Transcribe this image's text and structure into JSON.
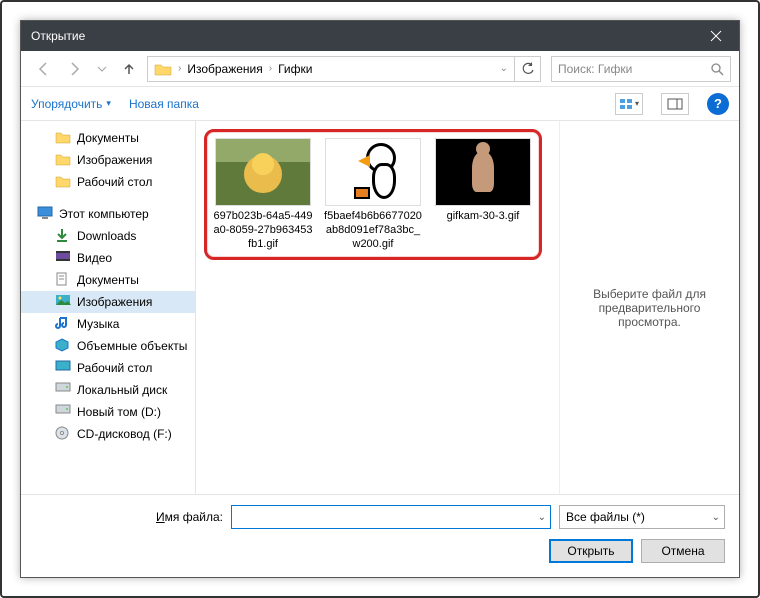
{
  "window": {
    "title": "Открытие"
  },
  "address": {
    "segments": [
      "Изображения",
      "Гифки"
    ]
  },
  "search": {
    "placeholder": "Поиск: Гифки"
  },
  "toolbar": {
    "organize": "Упорядочить",
    "new_folder": "Новая папка"
  },
  "tree": {
    "quick": [
      {
        "label": "Документы",
        "icon": "folder"
      },
      {
        "label": "Изображения",
        "icon": "folder"
      },
      {
        "label": "Рабочий стол",
        "icon": "folder"
      }
    ],
    "pc_label": "Этот компьютер",
    "pc_children": [
      {
        "label": "Downloads",
        "icon": "download"
      },
      {
        "label": "Видео",
        "icon": "video"
      },
      {
        "label": "Документы",
        "icon": "docs"
      },
      {
        "label": "Изображения",
        "icon": "pictures",
        "selected": true
      },
      {
        "label": "Музыка",
        "icon": "music"
      },
      {
        "label": "Объемные объекты",
        "icon": "3d"
      },
      {
        "label": "Рабочий стол",
        "icon": "desktop"
      },
      {
        "label": "Локальный диск",
        "icon": "drive"
      },
      {
        "label": "Новый том (D:)",
        "icon": "drive"
      },
      {
        "label": "CD-дисковод (F:)",
        "icon": "cd"
      }
    ]
  },
  "files": [
    {
      "name": "697b023b-64a5-449a0-8059-27b963453fb1.gif"
    },
    {
      "name": "f5baef4b6b6677020ab8d091ef78a3bc_w200.gif"
    },
    {
      "name": "gifkam-30-3.gif"
    }
  ],
  "preview_hint": "Выберите файл для предварительного просмотра.",
  "bottom": {
    "filename_label_u": "И",
    "filename_label_rest": "мя файла:",
    "filename_value": "",
    "filter": "Все файлы (*)",
    "open": "Открыть",
    "cancel": "Отмена"
  }
}
